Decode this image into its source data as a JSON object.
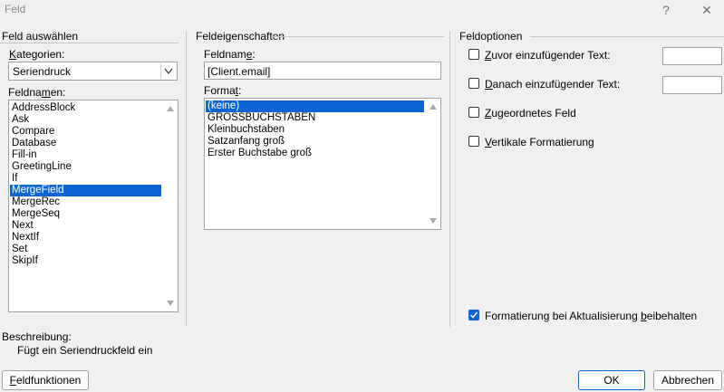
{
  "window": {
    "title": "Feld"
  },
  "titlebar": {
    "help_glyph": "?",
    "close_glyph": "✕"
  },
  "select_field": {
    "title": "Feld auswählen",
    "categories_label_pre": "",
    "categories_label_u": "K",
    "categories_label_post": "ategorien:",
    "category_value": "Seriendruck",
    "fieldnames_label_pre": "Feldna",
    "fieldnames_label_u": "m",
    "fieldnames_label_post": "en:",
    "fieldnames": [
      "AddressBlock",
      "Ask",
      "Compare",
      "Database",
      "Fill-in",
      "GreetingLine",
      "If",
      "MergeField",
      "MergeRec",
      "MergeSeq",
      "Next",
      "NextIf",
      "Set",
      "SkipIf"
    ],
    "selected_fieldname": "MergeField"
  },
  "field_properties": {
    "title": "Feldeigenschaften",
    "fieldname_label_pre": "Feldnam",
    "fieldname_label_u": "e",
    "fieldname_label_post": ":",
    "fieldname_value": "[Client.email]",
    "format_label_pre": "Forma",
    "format_label_u": "t",
    "format_label_post": ":",
    "formats": [
      "(keine)",
      "GROSSBUCHSTABEN",
      "Kleinbuchstaben",
      "Satzanfang groß",
      "Erster Buchstabe groß"
    ],
    "selected_format": "(keine)"
  },
  "field_options": {
    "title": "Feldoptionen",
    "opt1_u": "Z",
    "opt1_rest": "uvor einzufügender Text:",
    "opt2_u": "D",
    "opt2_rest": "anach einzufügender Text:",
    "opt3_u": "Z",
    "opt3_rest": "ugeordnetes Feld",
    "opt4_u": "V",
    "opt4_rest": "ertikale Formatierung",
    "preserve_pre": "Formatierung bei Aktualisierung ",
    "preserve_u": "b",
    "preserve_post": "eibehalten",
    "preserve_checked": true
  },
  "description": {
    "label": "Beschreibung:",
    "text": "Fügt ein Seriendruckfeld ein"
  },
  "buttons": {
    "field_codes_u": "F",
    "field_codes_rest": "eldfunktionen",
    "ok": "OK",
    "cancel": "Abbrechen"
  },
  "colors": {
    "selection": "#0a64d2",
    "background": "#f0f0f0"
  }
}
